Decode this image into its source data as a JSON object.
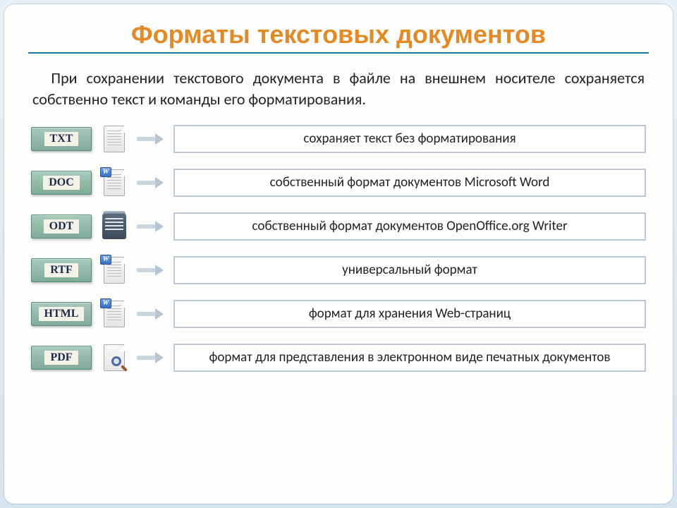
{
  "title": "Форматы текстовых документов",
  "intro": "При сохранении текстового документа в файле на внешнем носителе сохраняется собственно текст и команды его форматирования.",
  "formats": [
    {
      "ext": "TXT",
      "icon": "text-file-icon",
      "desc": "сохраняет текст без форматирования"
    },
    {
      "ext": "DOC",
      "icon": "word-file-icon",
      "desc": "собственный формат документов Microsoft Word"
    },
    {
      "ext": "ODT",
      "icon": "openoffice-file-icon",
      "desc": "собственный формат документов OpenOffice.org Writer"
    },
    {
      "ext": "RTF",
      "icon": "rtf-file-icon",
      "desc": "универсальный формат"
    },
    {
      "ext": "HTML",
      "icon": "html-file-icon",
      "desc": "формат для хранения Web-страниц"
    },
    {
      "ext": "PDF",
      "icon": "pdf-file-icon",
      "desc": "формат для представления в электронном виде печатных документов"
    }
  ]
}
